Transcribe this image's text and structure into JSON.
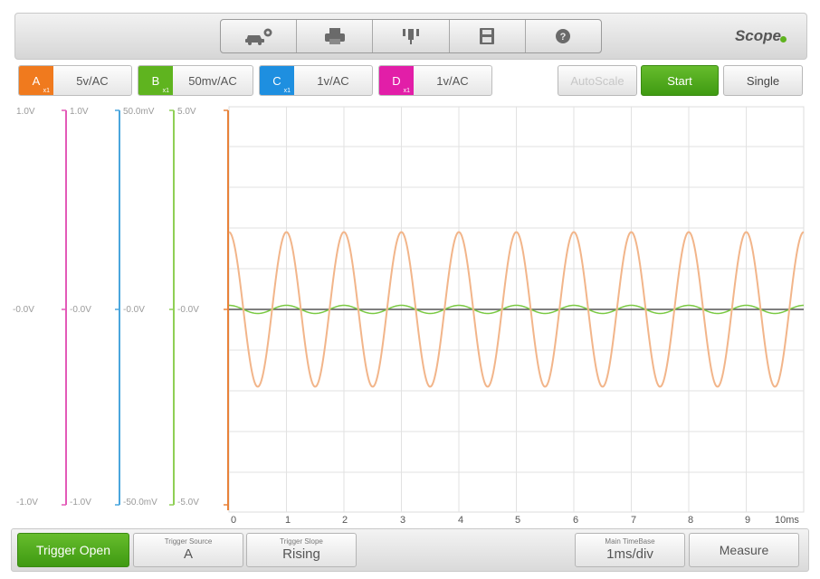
{
  "app": {
    "title": "Scope"
  },
  "toolbar": {
    "buttons": [
      {
        "icon": "vehicle-settings-icon"
      },
      {
        "icon": "print-icon"
      },
      {
        "icon": "probe-icon"
      },
      {
        "icon": "save-icon"
      },
      {
        "icon": "help-icon"
      }
    ]
  },
  "channels": [
    {
      "letter": "A",
      "gain": "x1",
      "range": "5v/AC",
      "color": "#f07a1e"
    },
    {
      "letter": "B",
      "gain": "x1",
      "range": "50mv/AC",
      "color": "#5fb41f"
    },
    {
      "letter": "C",
      "gain": "x1",
      "range": "1v/AC",
      "color": "#1e8fe0"
    },
    {
      "letter": "D",
      "gain": "x1",
      "range": "1v/AC",
      "color": "#e21ea8"
    }
  ],
  "controls": {
    "autoscale": "AutoScale",
    "start": "Start",
    "single": "Single"
  },
  "scales": {
    "d": {
      "top": "1.0V",
      "mid": "-0.0V",
      "bottom": "-1.0V"
    },
    "c": {
      "top": "1.0V",
      "mid": "-0.0V",
      "bottom": "-1.0V"
    },
    "b": {
      "top": "50.0mV",
      "mid": "-0.0V",
      "bottom": "-50.0mV"
    },
    "a": {
      "top": "5.0V",
      "mid": "-0.0V",
      "bottom": "-5.0V"
    }
  },
  "time_axis": {
    "labels": [
      "0",
      "1",
      "2",
      "3",
      "4",
      "5",
      "6",
      "7",
      "8",
      "9",
      "10ms"
    ]
  },
  "waveforms": {
    "a": {
      "cycles": 10,
      "amplitude_divs": 1.9,
      "color": "#f2b58a"
    },
    "b": {
      "cycles": 10,
      "amplitude_divs": 0.1,
      "color": "#7ac943"
    },
    "c": {
      "amplitude_divs": 0.0,
      "color": "#555555"
    }
  },
  "bottom": {
    "trigger_open": "Trigger Open",
    "trigger_source": {
      "caption": "Trigger Source",
      "value": "A"
    },
    "trigger_slope": {
      "caption": "Trigger Slope",
      "value": "Rising"
    },
    "timebase": {
      "caption": "Main TimeBase",
      "value": "1ms/div"
    },
    "measure": "Measure"
  }
}
